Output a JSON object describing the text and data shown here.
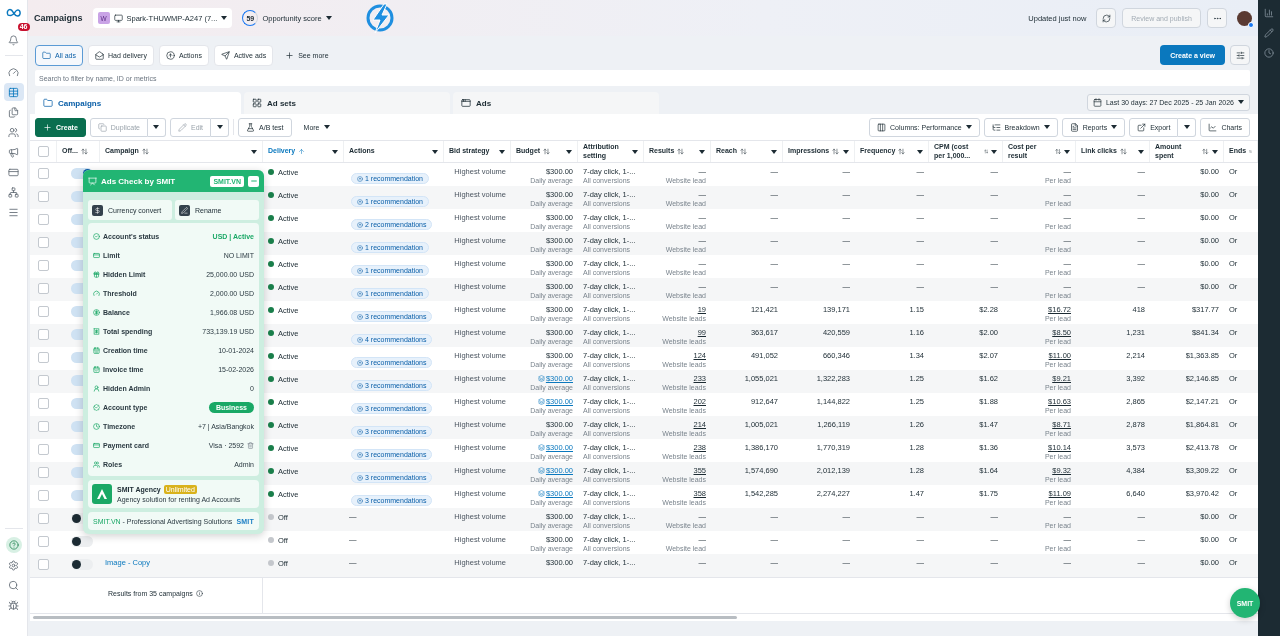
{
  "top_bar": {
    "title": "Campaigns",
    "account": {
      "initial": "W",
      "name": "Spark-THUWMP-A247 (7..."
    },
    "opportunity": {
      "score": "59",
      "label": "Opportunity score"
    },
    "updated": "Updated just now",
    "publish": {
      "label": "Review and publish",
      "disabled": true
    },
    "notifications_badge": "46"
  },
  "nav": [
    {
      "selected": false
    },
    {
      "selected": true
    },
    {
      "selected": false
    },
    {
      "selected": false
    },
    {
      "selected": false
    },
    {
      "selected": false
    },
    {
      "selected": false
    },
    {
      "selected": false
    }
  ],
  "filters": [
    {
      "label": "All ads",
      "selected": true
    },
    {
      "label": "Had delivery",
      "selected": false
    },
    {
      "label": "Actions",
      "selected": false
    },
    {
      "label": "Active ads",
      "selected": false
    },
    {
      "label": "See more",
      "selected": false
    }
  ],
  "create_view": "Create a view",
  "search": {
    "placeholder": "Search to filter by name, ID or metrics"
  },
  "tabs": [
    {
      "label": "Campaigns",
      "selected": true
    },
    {
      "label": "Ad sets",
      "selected": false
    },
    {
      "label": "Ads",
      "selected": false
    }
  ],
  "date_range": "Last 30 days: 27 Dec 2025 - 25 Jan 2026",
  "toolbar_left": [
    {
      "kind": "primary",
      "label": "Create",
      "disabled": false
    },
    {
      "kind": "split",
      "label": "Duplicate",
      "disabled": true
    },
    {
      "kind": "split",
      "label": "Edit",
      "disabled": true
    },
    {
      "kind": "outline",
      "label": "A/B test",
      "disabled": false
    },
    {
      "kind": "menu",
      "label": "More",
      "disabled": false
    }
  ],
  "toolbar_right": [
    {
      "kind": "outline-menu",
      "label": "Columns: Performance",
      "disabled": false
    },
    {
      "kind": "outline-menu",
      "label": "Breakdown",
      "disabled": false
    },
    {
      "kind": "outline-menu",
      "label": "Reports",
      "disabled": false
    },
    {
      "kind": "split",
      "label": "Export",
      "disabled": false
    },
    {
      "kind": "outline",
      "label": "Charts",
      "disabled": false
    }
  ],
  "table": {
    "header_checked": false,
    "columns": [
      {
        "label": "Off...",
        "sortable": true,
        "sorted": false,
        "menu": false
      },
      {
        "label": "Campaign",
        "sortable": true,
        "sorted": false,
        "menu": true
      },
      {
        "label": "Delivery",
        "sortable": true,
        "sorted": true,
        "menu": true
      },
      {
        "label": "Actions",
        "sortable": false,
        "sorted": false,
        "menu": true
      },
      {
        "label": "Bid strategy",
        "sortable": false,
        "sorted": false,
        "menu": true
      },
      {
        "label": "Budget",
        "sortable": true,
        "sorted": false,
        "menu": true
      },
      {
        "label": "Attribution setting",
        "sortable": false,
        "sorted": false,
        "menu": true
      },
      {
        "label": "Results",
        "sortable": true,
        "sorted": false,
        "menu": true
      },
      {
        "label": "Reach",
        "sortable": true,
        "sorted": false,
        "menu": true
      },
      {
        "label": "Impressions",
        "sortable": true,
        "sorted": false,
        "menu": true
      },
      {
        "label": "Frequency",
        "sortable": true,
        "sorted": false,
        "menu": true
      },
      {
        "label": "CPM (cost per 1,000...",
        "sortable": true,
        "sorted": false,
        "menu": true
      },
      {
        "label": "Cost per result",
        "sortable": true,
        "sorted": false,
        "menu": true
      },
      {
        "label": "Link clicks",
        "sortable": true,
        "sorted": false,
        "menu": true
      },
      {
        "label": "Amount spent",
        "sortable": true,
        "sorted": false,
        "menu": true
      },
      {
        "label": "Ends",
        "sortable": true,
        "sorted": false,
        "menu": false
      }
    ],
    "rows": [
      {
        "checked": false,
        "on": true,
        "delivery": "Active",
        "color": "#1a7f4b",
        "actions": {
          "kind": "chip",
          "text": "1 recommendation"
        },
        "bid": "Highest volume",
        "budget": {
          "value": "$300.00",
          "linked": false,
          "note": "Daily average"
        },
        "attribution": {
          "value": "7-day click, 1-...",
          "note": "All conversions"
        },
        "results": {
          "value": "—",
          "link": false,
          "note": "Website lead"
        },
        "reach": "—",
        "impressions": "—",
        "frequency": "—",
        "cpm": "—",
        "cost": {
          "value": "—",
          "link": false,
          "note": "Per lead"
        },
        "link_clicks": "—",
        "amount": "$0.00",
        "ends": "Or"
      },
      {
        "checked": false,
        "on": true,
        "delivery": "Active",
        "color": "#1a7f4b",
        "actions": {
          "kind": "chip",
          "text": "1 recommendation"
        },
        "bid": "Highest volume",
        "budget": {
          "value": "$300.00",
          "linked": false,
          "note": "Daily average"
        },
        "attribution": {
          "value": "7-day click, 1-...",
          "note": "All conversions"
        },
        "results": {
          "value": "—",
          "link": false,
          "note": "Website lead"
        },
        "reach": "—",
        "impressions": "—",
        "frequency": "—",
        "cpm": "—",
        "cost": {
          "value": "—",
          "link": false,
          "note": "Per lead"
        },
        "link_clicks": "—",
        "amount": "$0.00",
        "ends": "Or"
      },
      {
        "checked": false,
        "on": true,
        "delivery": "Active",
        "color": "#1a7f4b",
        "actions": {
          "kind": "chip",
          "text": "2 recommendations"
        },
        "bid": "Highest volume",
        "budget": {
          "value": "$300.00",
          "linked": false,
          "note": "Daily average"
        },
        "attribution": {
          "value": "7-day click, 1-...",
          "note": "All conversions"
        },
        "results": {
          "value": "—",
          "link": false,
          "note": "Website lead"
        },
        "reach": "—",
        "impressions": "—",
        "frequency": "—",
        "cpm": "—",
        "cost": {
          "value": "—",
          "link": false,
          "note": "Per lead"
        },
        "link_clicks": "—",
        "amount": "$0.00",
        "ends": "Or"
      },
      {
        "checked": false,
        "on": true,
        "delivery": "Active",
        "color": "#1a7f4b",
        "actions": {
          "kind": "chip",
          "text": "1 recommendation"
        },
        "bid": "Highest volume",
        "budget": {
          "value": "$300.00",
          "linked": false,
          "note": "Daily average"
        },
        "attribution": {
          "value": "7-day click, 1-...",
          "note": "All conversions"
        },
        "results": {
          "value": "—",
          "link": false,
          "note": "Website lead"
        },
        "reach": "—",
        "impressions": "—",
        "frequency": "—",
        "cpm": "—",
        "cost": {
          "value": "—",
          "link": false,
          "note": "Per lead"
        },
        "link_clicks": "—",
        "amount": "$0.00",
        "ends": "Or"
      },
      {
        "checked": false,
        "on": true,
        "delivery": "Active",
        "color": "#1a7f4b",
        "actions": {
          "kind": "chip",
          "text": "1 recommendation"
        },
        "bid": "Highest volume",
        "budget": {
          "value": "$300.00",
          "linked": false,
          "note": "Daily average"
        },
        "attribution": {
          "value": "7-day click, 1-...",
          "note": "All conversions"
        },
        "results": {
          "value": "—",
          "link": false,
          "note": "Website lead"
        },
        "reach": "—",
        "impressions": "—",
        "frequency": "—",
        "cpm": "—",
        "cost": {
          "value": "—",
          "link": false,
          "note": "Per lead"
        },
        "link_clicks": "—",
        "amount": "$0.00",
        "ends": "Or"
      },
      {
        "checked": false,
        "on": true,
        "delivery": "Active",
        "color": "#1a7f4b",
        "actions": {
          "kind": "chip",
          "text": "1 recommendation"
        },
        "bid": "Highest volume",
        "budget": {
          "value": "$300.00",
          "linked": false,
          "note": "Daily average"
        },
        "attribution": {
          "value": "7-day click, 1-...",
          "note": "All conversions"
        },
        "results": {
          "value": "—",
          "link": false,
          "note": "Website lead"
        },
        "reach": "—",
        "impressions": "—",
        "frequency": "—",
        "cpm": "—",
        "cost": {
          "value": "—",
          "link": false,
          "note": "Per lead"
        },
        "link_clicks": "—",
        "amount": "$0.00",
        "ends": "Or"
      },
      {
        "checked": false,
        "on": true,
        "delivery": "Active",
        "color": "#1a7f4b",
        "actions": {
          "kind": "chip",
          "text": "3 recommendations"
        },
        "bid": "Highest volume",
        "budget": {
          "value": "$300.00",
          "linked": false,
          "note": "Daily average"
        },
        "attribution": {
          "value": "7-day click, 1-...",
          "note": "All conversions"
        },
        "results": {
          "value": "19",
          "link": true,
          "note": "Website leads"
        },
        "reach": "121,421",
        "impressions": "139,171",
        "frequency": "1.15",
        "cpm": "$2.28",
        "cost": {
          "value": "$16.72",
          "link": true,
          "note": "Per lead"
        },
        "link_clicks": "418",
        "amount": "$317.77",
        "ends": "Or"
      },
      {
        "checked": false,
        "on": true,
        "delivery": "Active",
        "color": "#1a7f4b",
        "actions": {
          "kind": "chip",
          "text": "4 recommendations"
        },
        "bid": "Highest volume",
        "budget": {
          "value": "$300.00",
          "linked": false,
          "note": "Daily average"
        },
        "attribution": {
          "value": "7-day click, 1-...",
          "note": "All conversions"
        },
        "results": {
          "value": "99",
          "link": true,
          "note": "Website leads"
        },
        "reach": "363,617",
        "impressions": "420,559",
        "frequency": "1.16",
        "cpm": "$2.00",
        "cost": {
          "value": "$8.50",
          "link": true,
          "note": "Per lead"
        },
        "link_clicks": "1,231",
        "amount": "$841.34",
        "ends": "Or"
      },
      {
        "checked": false,
        "on": true,
        "delivery": "Active",
        "color": "#1a7f4b",
        "actions": {
          "kind": "chip",
          "text": "3 recommendations"
        },
        "bid": "Highest volume",
        "budget": {
          "value": "$300.00",
          "linked": false,
          "note": "Daily average"
        },
        "attribution": {
          "value": "7-day click, 1-...",
          "note": "All conversions"
        },
        "results": {
          "value": "124",
          "link": true,
          "note": "Website leads"
        },
        "reach": "491,052",
        "impressions": "660,346",
        "frequency": "1.34",
        "cpm": "$2.07",
        "cost": {
          "value": "$11.00",
          "link": true,
          "note": "Per lead"
        },
        "link_clicks": "2,214",
        "amount": "$1,363.85",
        "ends": "Or"
      },
      {
        "checked": false,
        "on": true,
        "delivery": "Active",
        "color": "#1a7f4b",
        "actions": {
          "kind": "chip",
          "text": "3 recommendations"
        },
        "bid": "Highest volume",
        "budget": {
          "value": "$300.00",
          "linked": true,
          "note": "Daily average"
        },
        "attribution": {
          "value": "7-day click, 1-...",
          "note": "All conversions"
        },
        "results": {
          "value": "233",
          "link": true,
          "note": "Website leads"
        },
        "reach": "1,055,021",
        "impressions": "1,322,283",
        "frequency": "1.25",
        "cpm": "$1.62",
        "cost": {
          "value": "$9.21",
          "link": true,
          "note": "Per lead"
        },
        "link_clicks": "3,392",
        "amount": "$2,146.85",
        "ends": "Or"
      },
      {
        "checked": false,
        "on": true,
        "delivery": "Active",
        "color": "#1a7f4b",
        "actions": {
          "kind": "chip",
          "text": "3 recommendations"
        },
        "bid": "Highest volume",
        "budget": {
          "value": "$300.00",
          "linked": true,
          "note": "Daily average"
        },
        "attribution": {
          "value": "7-day click, 1-...",
          "note": "All conversions"
        },
        "results": {
          "value": "202",
          "link": true,
          "note": "Website leads"
        },
        "reach": "912,647",
        "impressions": "1,144,822",
        "frequency": "1.25",
        "cpm": "$1.88",
        "cost": {
          "value": "$10.63",
          "link": true,
          "note": "Per lead"
        },
        "link_clicks": "2,865",
        "amount": "$2,147.21",
        "ends": "Or"
      },
      {
        "checked": false,
        "on": true,
        "delivery": "Active",
        "color": "#1a7f4b",
        "actions": {
          "kind": "chip",
          "text": "3 recommendations"
        },
        "bid": "Highest volume",
        "budget": {
          "value": "$300.00",
          "linked": false,
          "note": "Daily average"
        },
        "attribution": {
          "value": "7-day click, 1-...",
          "note": "All conversions"
        },
        "results": {
          "value": "214",
          "link": true,
          "note": "Website leads"
        },
        "reach": "1,005,021",
        "impressions": "1,266,119",
        "frequency": "1.26",
        "cpm": "$1.47",
        "cost": {
          "value": "$8.71",
          "link": true,
          "note": "Per lead"
        },
        "link_clicks": "2,878",
        "amount": "$1,864.81",
        "ends": "Or"
      },
      {
        "checked": false,
        "on": true,
        "delivery": "Active",
        "color": "#1a7f4b",
        "actions": {
          "kind": "chip",
          "text": "3 recommendations"
        },
        "bid": "Highest volume",
        "budget": {
          "value": "$300.00",
          "linked": true,
          "note": "Daily average"
        },
        "attribution": {
          "value": "7-day click, 1-...",
          "note": "All conversions"
        },
        "results": {
          "value": "238",
          "link": true,
          "note": "Website leads"
        },
        "reach": "1,386,170",
        "impressions": "1,770,319",
        "frequency": "1.28",
        "cpm": "$1.36",
        "cost": {
          "value": "$10.14",
          "link": true,
          "note": "Per lead"
        },
        "link_clicks": "3,573",
        "amount": "$2,413.78",
        "ends": "Or"
      },
      {
        "checked": false,
        "on": true,
        "delivery": "Active",
        "color": "#1a7f4b",
        "actions": {
          "kind": "chip",
          "text": "3 recommendations"
        },
        "bid": "Highest volume",
        "budget": {
          "value": "$300.00",
          "linked": true,
          "note": "Daily average"
        },
        "attribution": {
          "value": "7-day click, 1-...",
          "note": "All conversions"
        },
        "results": {
          "value": "355",
          "link": true,
          "note": "Website leads"
        },
        "reach": "1,574,690",
        "impressions": "2,012,139",
        "frequency": "1.28",
        "cpm": "$1.64",
        "cost": {
          "value": "$9.32",
          "link": true,
          "note": "Per lead"
        },
        "link_clicks": "4,384",
        "amount": "$3,309.22",
        "ends": "Or"
      },
      {
        "checked": false,
        "on": true,
        "delivery": "Active",
        "color": "#1a7f4b",
        "actions": {
          "kind": "chip",
          "text": "3 recommendations"
        },
        "bid": "Highest volume",
        "budget": {
          "value": "$300.00",
          "linked": true,
          "note": "Daily average"
        },
        "attribution": {
          "value": "7-day click, 1-...",
          "note": "All conversions"
        },
        "results": {
          "value": "358",
          "link": true,
          "note": "Website leads"
        },
        "reach": "1,542,285",
        "impressions": "2,274,227",
        "frequency": "1.47",
        "cpm": "$1.75",
        "cost": {
          "value": "$11.09",
          "link": true,
          "note": "Per lead"
        },
        "link_clicks": "6,640",
        "amount": "$3,970.42",
        "ends": "Or"
      },
      {
        "checked": false,
        "on": false,
        "delivery": "Off",
        "color": "#c4c7cc",
        "actions": {
          "kind": "dash",
          "text": "—"
        },
        "bid": "Highest volume",
        "budget": {
          "value": "$300.00",
          "linked": false,
          "note": "Daily average"
        },
        "attribution": {
          "value": "7-day click, 1-...",
          "note": "All conversions"
        },
        "results": {
          "value": "—",
          "link": false,
          "note": "Website lead"
        },
        "reach": "—",
        "impressions": "—",
        "frequency": "—",
        "cpm": "—",
        "cost": {
          "value": "—",
          "link": false,
          "note": "Per lead"
        },
        "link_clicks": "—",
        "amount": "$0.00",
        "ends": "Or"
      },
      {
        "checked": false,
        "on": false,
        "delivery": "Off",
        "color": "#c4c7cc",
        "actions": {
          "kind": "dash",
          "text": "—"
        },
        "bid": "Highest volume",
        "budget": {
          "value": "$300.00",
          "linked": false,
          "note": "Daily average"
        },
        "attribution": {
          "value": "7-day click, 1-...",
          "note": "All conversions"
        },
        "results": {
          "value": "—",
          "link": false,
          "note": "Website lead"
        },
        "reach": "—",
        "impressions": "—",
        "frequency": "—",
        "cpm": "—",
        "cost": {
          "value": "—",
          "link": false,
          "note": "Per lead"
        },
        "link_clicks": "—",
        "amount": "$0.00",
        "ends": "Or"
      },
      {
        "checked": false,
        "on": false,
        "campaign": "Image - Copy",
        "delivery": "Off",
        "color": "#c4c7cc",
        "actions": {
          "kind": "dash",
          "text": "—"
        },
        "bid": "Highest volume",
        "budget": {
          "value": "$300.00",
          "linked": false
        },
        "attribution": {
          "value": "7-day click, 1-..."
        },
        "results": {
          "value": "—",
          "link": false
        },
        "reach": "—",
        "impressions": "—",
        "frequency": "—",
        "cpm": "—",
        "cost": {
          "value": "—",
          "link": false
        },
        "link_clicks": "—",
        "amount": "$0.00",
        "ends": "Or"
      }
    ],
    "footer": "Results from 35 campaigns"
  },
  "smit_panel": {
    "title": "Ads Check by SMIT",
    "badge": "SMIT.VN",
    "buttons": [
      "Currency convert",
      "Rename"
    ],
    "info": [
      {
        "kind": "status",
        "label": "Account's status",
        "value": "USD | Active"
      },
      {
        "kind": "text",
        "label": "Limit",
        "value": "NO LIMIT"
      },
      {
        "kind": "text",
        "label": "Hidden Limit",
        "value": "25,000.00 USD"
      },
      {
        "kind": "text",
        "label": "Threshold",
        "value": "2,000.00 USD"
      },
      {
        "kind": "text",
        "label": "Balance",
        "value": "1,966.08 USD"
      },
      {
        "kind": "text",
        "label": "Total spending",
        "value": "733,139.19 USD"
      },
      {
        "kind": "text",
        "label": "Creation time",
        "value": "10-01-2024"
      },
      {
        "kind": "text",
        "label": "Invoice time",
        "value": "15-02-2026"
      },
      {
        "kind": "text",
        "label": "Hidden Admin",
        "value": "0"
      },
      {
        "kind": "pill",
        "label": "Account type",
        "value": "Business"
      },
      {
        "kind": "text",
        "label": "Timezone",
        "value": "+7 | Asia/Bangkok"
      },
      {
        "kind": "card",
        "label": "Payment card",
        "value": "Visa · 2592"
      },
      {
        "kind": "text",
        "label": "Roles",
        "value": "Admin"
      }
    ],
    "agency": {
      "name": "SMIT Agency",
      "tag": "Unlimited",
      "text": "Agency solution for renting Ad Accounts"
    },
    "footer": {
      "brand": "SMIT.VN",
      "text": " - Professional Advertising Solutions",
      "logo": "SMIT"
    }
  },
  "smit_button": "SMIT"
}
